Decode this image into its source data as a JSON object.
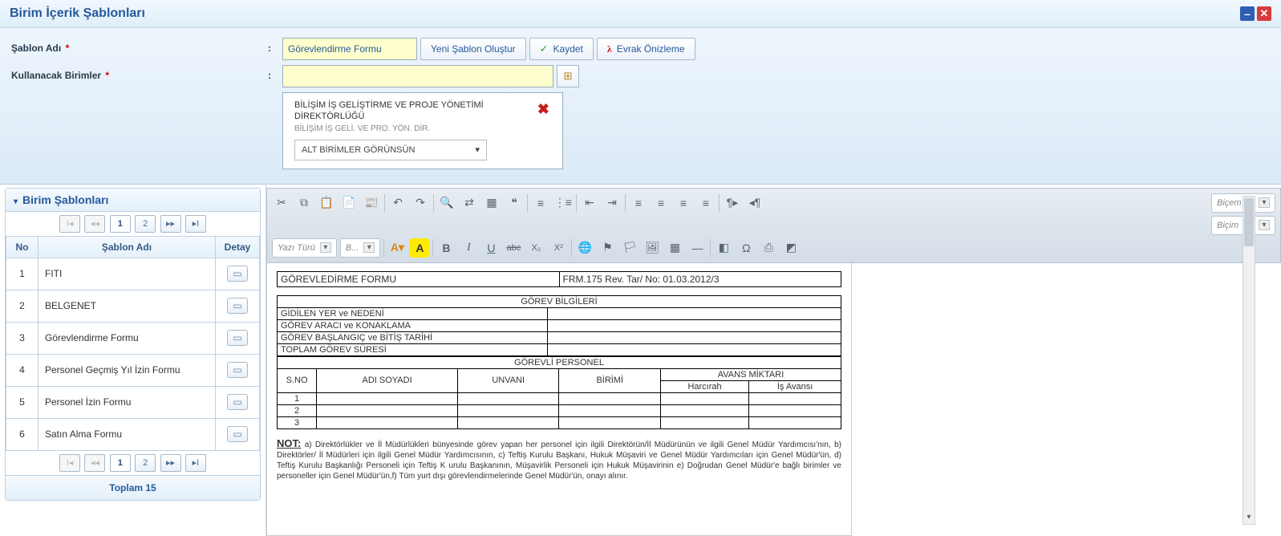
{
  "window": {
    "title": "Birim İçerik Şablonları"
  },
  "form": {
    "label_template_name": "Şablon Adı",
    "label_units": "Kullanacak Birimler",
    "template_name_value": "Görevlendirme Formu",
    "btn_new_template": "Yeni Şablon Oluştur",
    "btn_save": "Kaydet",
    "btn_preview": "Evrak Önizleme",
    "unit": {
      "name": "BİLİŞİM İŞ GELİŞTİRME VE PROJE YÖNETİMİ DİREKTÖRLÜĞÜ",
      "sub": "BİLİŞİM İŞ GELİ. VE PRO. YÖN. DİR.",
      "option_selected": "ALT BİRİMLER GÖRÜNSÜN"
    }
  },
  "panel": {
    "title": "Birim Şablonları",
    "col_no": "No",
    "col_name": "Şablon Adı",
    "col_detail": "Detay",
    "rows": [
      {
        "no": "1",
        "name": "FITI"
      },
      {
        "no": "2",
        "name": "BELGENET"
      },
      {
        "no": "3",
        "name": "Görevlendirme Formu"
      },
      {
        "no": "4",
        "name": "Personel Geçmiş Yıl İzin Formu"
      },
      {
        "no": "5",
        "name": "Personel İzin Formu"
      },
      {
        "no": "6",
        "name": "Satın Alma Formu"
      }
    ],
    "pager_pages": [
      "1",
      "2"
    ],
    "total_label": "Toplam 15"
  },
  "editor": {
    "dd_style": "Biçem",
    "dd_format": "Biçim",
    "dd_font": "Yazı Türü",
    "dd_size": "B...",
    "doc": {
      "title": "GÖREVLEDİRME FORMU",
      "rev": "FRM.175 Rev. Tar/ No: 01.03.2012/3",
      "sec1_title": "GÖREV BİLGİLERİ",
      "sec1_rows": [
        "GİDİLEN YER ve NEDENİ",
        "GÖREV ARACI ve KONAKLAMA",
        "GÖREV BAŞLANGIÇ ve BİTİŞ TARİHİ",
        "TOPLAM GÖREV SÜRESİ"
      ],
      "sec2_title": "GÖREVLİ PERSONEL",
      "sec2_headers": {
        "sno": "S.NO",
        "name": "ADI SOYADI",
        "title": "UNVANI",
        "unit": "BİRİMİ",
        "avans": "AVANS MİKTARI",
        "harc": "Harcırah",
        "isav": "İş Avansı"
      },
      "sec2_rownums": [
        "1",
        "2",
        "3"
      ],
      "note_label": "NOT:",
      "note_text": "a) Direktörlükler ve İl Müdürlükleri bünyesinde görev yapan her personel için ilgili Direktörün/İl Müdürünün ve ilgili Genel Müdür Yardımcısı'nın, b) Direktörler/ İl Müdürleri için ilgili Genel Müdür Yardımcısının, c) Teftiş Kurulu Başkanı, Hukuk Müşaviri ve Genel Müdür Yardımcıları için Genel Müdür'ün, d) Teftiş Kurulu Başkanlığı Personeli için Teftiş K urulu Başkanının, Müşavirlik Personeli için Hukuk Müşavirinin e) Doğrudan Genel Müdür'e bağlı birimler ve personeller için Genel Müdür'ün,f) Tüm yurt dışı görevlendirmelerinde Genel Müdür'ün, onayı alınır."
    }
  }
}
